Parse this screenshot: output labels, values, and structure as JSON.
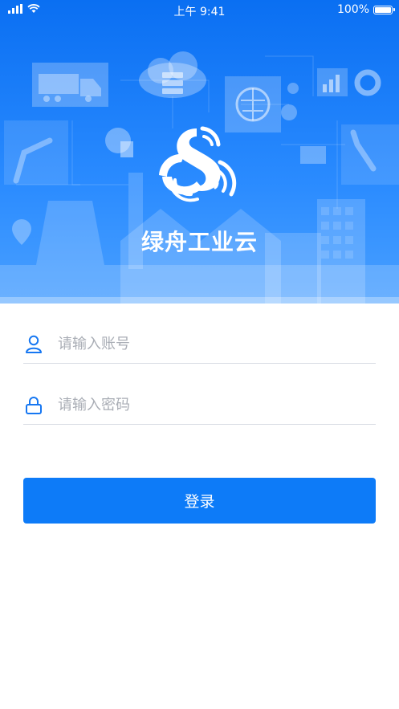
{
  "status_bar": {
    "time": "上午 9:41",
    "battery": "100%",
    "signal_icon": "cellular-signal-icon",
    "wifi_icon": "wifi-icon",
    "battery_icon": "battery-icon"
  },
  "app": {
    "title": "绿舟工业云",
    "logo_icon": "app-logo-icon",
    "brand_color": "#0d7bf8"
  },
  "form": {
    "account": {
      "placeholder": "请输入账号",
      "value": "",
      "icon": "user-icon"
    },
    "password": {
      "placeholder": "请输入密码",
      "value": "",
      "icon": "lock-icon"
    }
  },
  "login_button": {
    "label": "登录"
  }
}
